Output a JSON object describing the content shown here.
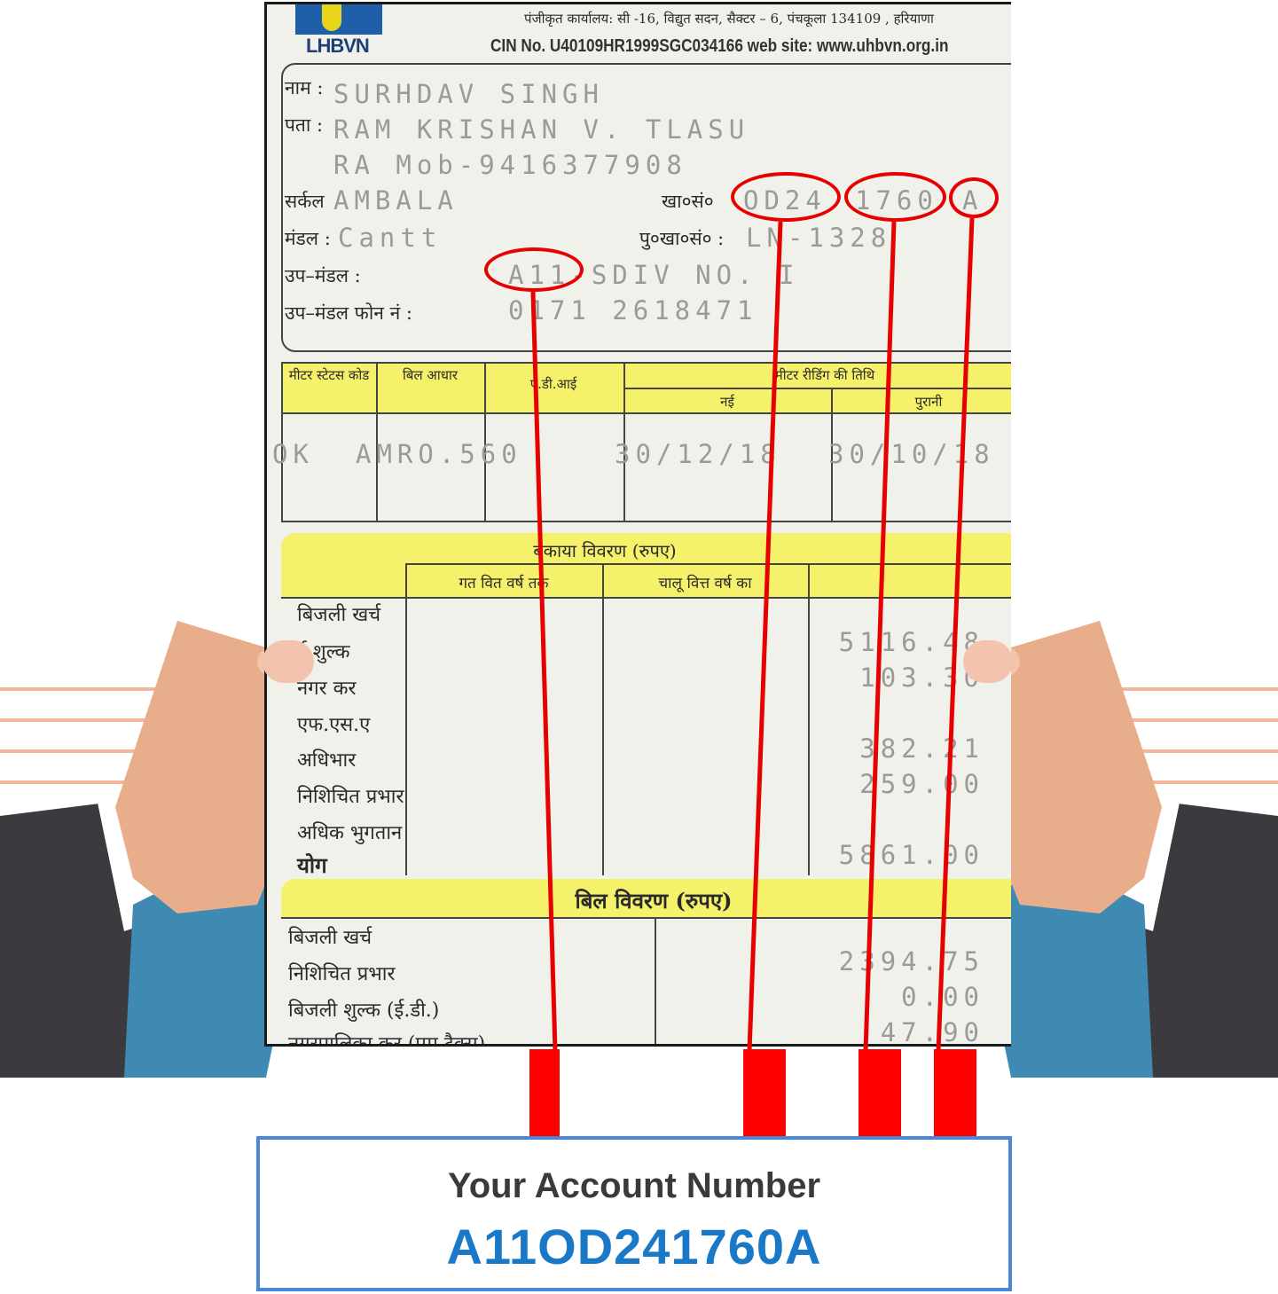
{
  "bill": {
    "logo_text": "LHBVN",
    "header_line1": "पंजीकृत कार्यालय: सी -16, विद्युत सदन, सैक्टर – 6, पंचकूला 134109 , हरियाणा",
    "header_line2": "CIN No. U40109HR1999SGC034166 web site: www.uhbvn.org.in",
    "labels": {
      "name": "नाम :",
      "address": "पता :",
      "circle": "सर्कल",
      "account_no": "खा०सं०",
      "division": "मंडल :",
      "old_account_no": "पु०खा०सं० :",
      "sub_division": "उप–मंडल :",
      "sub_division_phone": "उप–मंडल फोन नं :"
    },
    "values": {
      "name": "SURHDAV SINGH",
      "address_line1": "RAM KRISHAN V. TLASU",
      "address_line2": "RA Mob-9416377908",
      "circle": "AMBALA",
      "division": "Cantt",
      "account_no_part1": "OD24",
      "account_no_part2": "1760",
      "account_no_part3": "A",
      "old_account_no": "LN-1328",
      "sub_division": "A11-SDIV NO. I",
      "sub_division_phone": "0171 2618471"
    },
    "meter_table": {
      "headers": [
        "मीटर स्टेटस कोड",
        "बिल आधार",
        "ए.डी.आई",
        "मीटर रीडिंग की तिथि",
        "नई",
        "पुरानी"
      ],
      "row": [
        "OK",
        "AMRO.560",
        "",
        "30/12/18",
        "30/10/18"
      ]
    },
    "arrears": {
      "title": "बकाया विवरण (रुपए)",
      "col_headers": [
        "गत वित वर्ष तक",
        "चालू वित्त वर्ष का"
      ],
      "rows": [
        {
          "label": "बिजली खर्च",
          "amount": ""
        },
        {
          "label": "ई शुल्क",
          "amount": "5116.48"
        },
        {
          "label": "नगर कर",
          "amount": "103.30"
        },
        {
          "label": "एफ.एस.ए",
          "amount": ""
        },
        {
          "label": "अधिभार",
          "amount": "382.21"
        },
        {
          "label": "निशिचित प्रभार",
          "amount": "259.00"
        },
        {
          "label": "अधिक भुगतान",
          "amount": ""
        },
        {
          "label": "योग",
          "amount": "5861.00"
        }
      ]
    },
    "bill_details": {
      "title": "बिल विवरण (रुपए)",
      "rows": [
        {
          "label": "बिजली खर्च",
          "amount": ""
        },
        {
          "label": "निशिचित प्रभार",
          "amount": "2394.75"
        },
        {
          "label": "बिजली शुल्क (ई.डी.)",
          "amount": "0.00"
        },
        {
          "label": "नगरपालिका कर (एम टैक्स)",
          "amount": "47.90"
        }
      ]
    }
  },
  "result": {
    "title": "Your Account Number",
    "account_number": "A11OD241760A"
  },
  "colors": {
    "highlight": "#e60000",
    "result_border": "#4a86d9",
    "result_value": "#1a78c9",
    "bill_yellow": "#f5f16a",
    "skin": "#e8ad8a",
    "sleeve_blue": "#3f8ab3",
    "jacket": "#3a3a3f"
  }
}
